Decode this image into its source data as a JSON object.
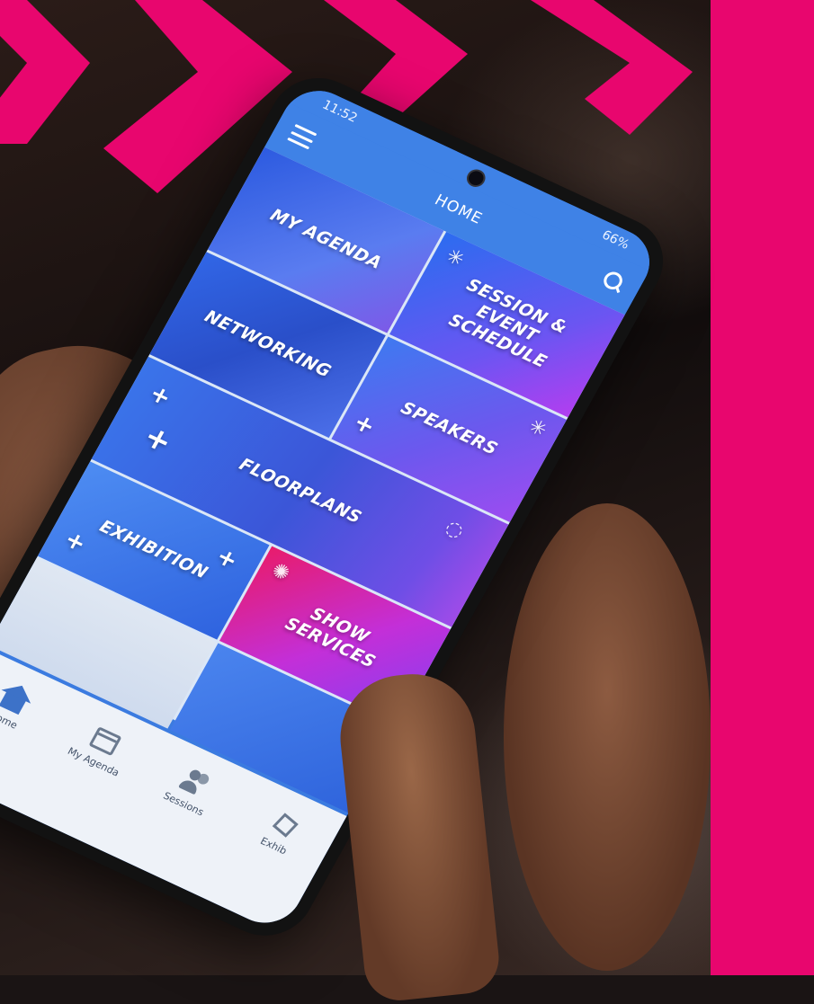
{
  "status": {
    "time": "11:52",
    "battery": "66%"
  },
  "appbar": {
    "title": "HOME"
  },
  "tiles": {
    "my_agenda": "MY AGENDA",
    "session_schedule": "SESSION & EVENT SCHEDULE",
    "networking": "NETWORKING",
    "speakers": "SPEAKERS",
    "floorplans": "FLOORPLANS",
    "exhibition": "EXHIBITION",
    "show_services": "SHOW SERVICES"
  },
  "bottom_nav": {
    "home": "Home",
    "my_agenda": "My Agenda",
    "sessions": "Sessions",
    "exhibitors": "Exhib"
  },
  "colors": {
    "brand_pink": "#e8066e",
    "app_blue": "#3f82e6",
    "tile_purple": "#8a3ef0"
  }
}
